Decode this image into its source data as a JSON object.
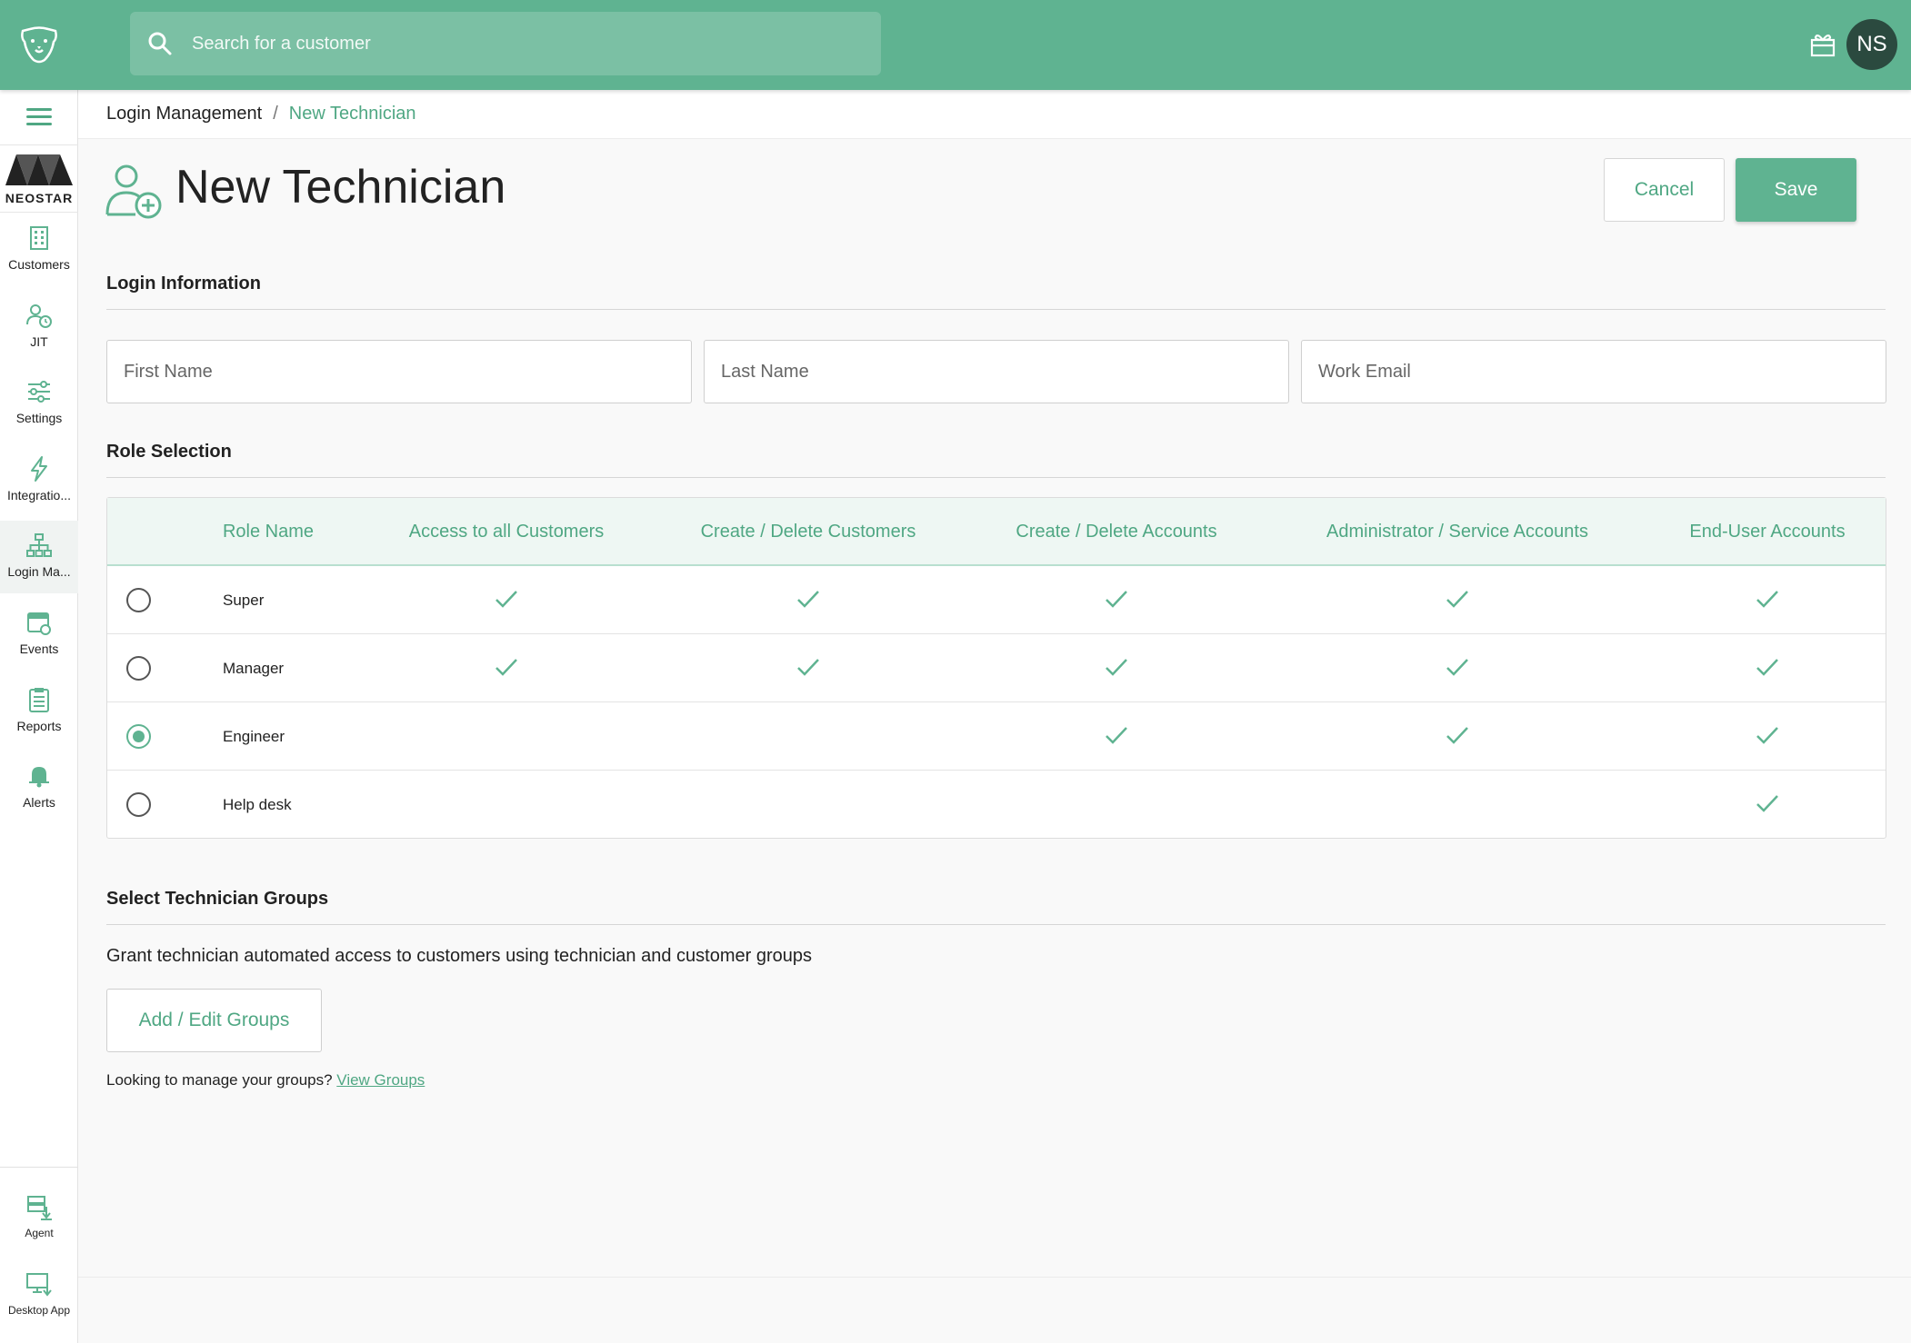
{
  "search": {
    "placeholder": "Search for a customer"
  },
  "user": {
    "initials": "NS"
  },
  "brand": {
    "name": "NEOSTAR"
  },
  "sidebar": {
    "items": [
      {
        "label": "Customers",
        "icon": "building-icon"
      },
      {
        "label": "JIT",
        "icon": "user-clock-icon"
      },
      {
        "label": "Settings",
        "icon": "sliders-icon"
      },
      {
        "label": "Integratio...",
        "icon": "lightning-icon"
      },
      {
        "label": "Login Ma...",
        "icon": "org-chart-icon",
        "active": true
      },
      {
        "label": "Events",
        "icon": "calendar-icon"
      },
      {
        "label": "Reports",
        "icon": "clipboard-icon"
      },
      {
        "label": "Alerts",
        "icon": "bell-icon"
      }
    ],
    "bottom_items": [
      {
        "label": "Agent",
        "icon": "server-download-icon"
      },
      {
        "label": "Desktop App",
        "icon": "monitor-download-icon"
      }
    ]
  },
  "breadcrumb": {
    "parent": "Login Management",
    "separator": "/",
    "current": "New Technician"
  },
  "page": {
    "title": "New Technician"
  },
  "actions": {
    "cancel": "Cancel",
    "save": "Save"
  },
  "login_info": {
    "title": "Login Information",
    "first_name_placeholder": "First Name",
    "last_name_placeholder": "Last Name",
    "email_placeholder": "Work Email"
  },
  "role_selection": {
    "title": "Role Selection",
    "columns": [
      "Role Name",
      "Access to all Customers",
      "Create / Delete Customers",
      "Create / Delete Accounts",
      "Administrator / Service Accounts",
      "End-User Accounts"
    ],
    "rows": [
      {
        "name": "Super",
        "selected": false,
        "perms": [
          true,
          true,
          true,
          true,
          true
        ]
      },
      {
        "name": "Manager",
        "selected": false,
        "perms": [
          true,
          true,
          true,
          true,
          true
        ]
      },
      {
        "name": "Engineer",
        "selected": true,
        "perms": [
          false,
          false,
          true,
          true,
          true
        ]
      },
      {
        "name": "Help desk",
        "selected": false,
        "perms": [
          false,
          false,
          false,
          false,
          true
        ]
      }
    ]
  },
  "groups": {
    "title": "Select Technician Groups",
    "description": "Grant technician automated access to customers using technician and customer groups",
    "button": "Add / Edit Groups",
    "manage_text": "Looking to manage your groups?",
    "manage_link": "View Groups"
  },
  "colors": {
    "brand_green": "#5fb391",
    "accent_text": "#4fa783",
    "avatar_bg": "#2b4a3f"
  }
}
